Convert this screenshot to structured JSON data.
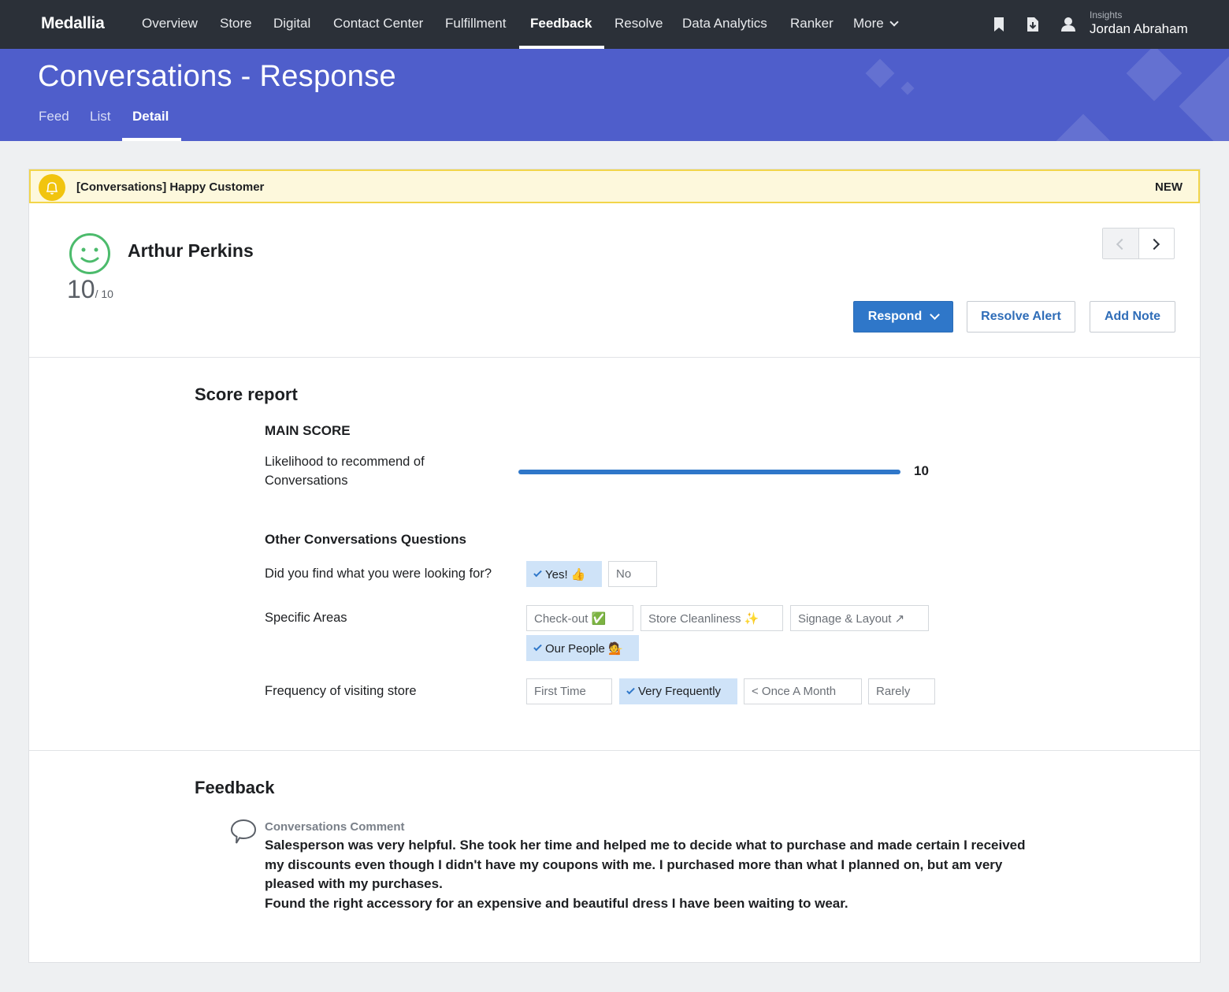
{
  "brand": "Medallia",
  "nav": {
    "items": [
      "Overview",
      "Store",
      "Digital",
      "Contact Center",
      "Fulfillment",
      "Feedback",
      "Resolve",
      "Data Analytics",
      "Ranker"
    ],
    "more_label": "More",
    "active": "Feedback"
  },
  "user": {
    "context": "Insights",
    "name": "Jordan Abraham"
  },
  "page": {
    "title": "Conversations - Response",
    "tabs": [
      "Feed",
      "List",
      "Detail"
    ],
    "active_tab": "Detail"
  },
  "alert": {
    "text": "[Conversations] Happy Customer",
    "status": "NEW"
  },
  "respondent": {
    "name": "Arthur Perkins",
    "score": "10",
    "score_max": "/ 10"
  },
  "actions": {
    "respond": "Respond",
    "resolve": "Resolve Alert",
    "add_note": "Add Note"
  },
  "score_report": {
    "title": "Score report",
    "main_heading": "MAIN SCORE",
    "main_question": "Likelihood to recommend of Conversations",
    "main_value": "10",
    "main_fraction": 1.0,
    "other_heading": "Other Conversations Questions",
    "questions": [
      {
        "label": "Did you find what you were looking for?",
        "options": [
          "Yes! 👍",
          "No"
        ],
        "selected": [
          "Yes! 👍"
        ]
      },
      {
        "label": "Specific Areas",
        "options": [
          "Check-out ✅",
          "Store Cleanliness ✨",
          "Signage & Layout ↗",
          "Our People 💁"
        ],
        "selected": [
          "Our People 💁"
        ]
      },
      {
        "label": "Frequency of visiting store",
        "options": [
          "First Time",
          "Very Frequently",
          "< Once A Month",
          "Rarely"
        ],
        "selected": [
          "Very Frequently"
        ]
      }
    ]
  },
  "feedback": {
    "title": "Feedback",
    "comment_label": "Conversations Comment",
    "comment_text": "Salesperson was very helpful. She took her time and helped me to decide what to purchase and made certain I received my discounts even though I didn't have my coupons with me. I purchased more than what I planned on, but am very pleased with my purchases.\nFound the right accessory for an expensive and beautiful dress I have been waiting to wear."
  },
  "colors": {
    "nav_bg": "#2b3038",
    "banner_bg": "#4f5ecb",
    "accent": "#2f77c9",
    "alert_bg": "#fdf8dc",
    "alert_border": "#f2d54a",
    "smiley": "#4cbb6c",
    "chip_selected": "#cfe3f8"
  }
}
